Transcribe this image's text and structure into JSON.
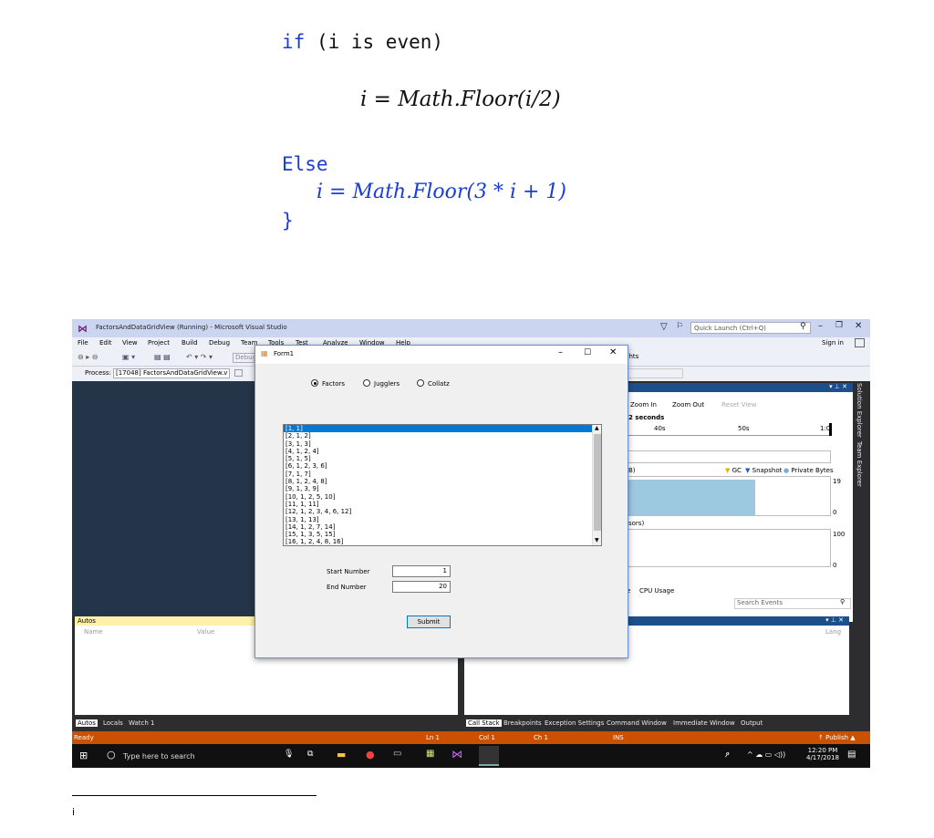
{
  "code": {
    "if_line": "if (i is even)",
    "even_formula": "i = Math.Floor(i/2)",
    "else_kw": "Else",
    "odd_formula": "i = Math.Floor(3 * i + 1)",
    "close_brace": "}"
  },
  "vs": {
    "title": "FactorsAndDataGridView (Running) - Microsoft Visual Studio",
    "quick_launch": "Quick Launch (Ctrl+Q)",
    "sign_in": "Sign in",
    "menu": [
      "File",
      "Edit",
      "View",
      "Project",
      "Build",
      "Debug",
      "Team",
      "Tools",
      "Test",
      "Analyze",
      "Window",
      "Help"
    ],
    "process_label": "Process:",
    "process_value": "[17048] FactorsAndDataGridView.v",
    "toolbar_debug": "Debug",
    "insights": "ghts",
    "diag": {
      "zoom_in": "Zoom In",
      "zoom_out": "Zoom Out",
      "reset_view": "Reset View",
      "seconds": "2 seconds",
      "ticks": [
        "40s",
        "50s",
        "1:0"
      ],
      "memory_label": "B)",
      "legend_gc": "GC",
      "legend_snapshot": "Snapshot",
      "legend_private": "Private Bytes",
      "mem_max": "19",
      "mem_min": "0",
      "cpu_label": "sors)",
      "cpu_max": "100",
      "cpu_min": "0",
      "tab_events": "e",
      "tab_cpu": "CPU Usage",
      "search_events": "Search Events"
    },
    "side_tabs": [
      "Solution Explorer",
      "Team Explorer"
    ],
    "autos": {
      "title": "Autos",
      "col_name": "Name",
      "col_value": "Value"
    },
    "callstack": {
      "col_lang": "Lang"
    },
    "bottom_left_tabs": [
      "Autos",
      "Locals",
      "Watch 1"
    ],
    "bottom_right_tabs": [
      "Call Stack",
      "Breakpoints",
      "Exception Settings",
      "Command Window",
      "Immediate Window",
      "Output"
    ],
    "status": {
      "ready": "Ready",
      "ln": "Ln 1",
      "col": "Col 1",
      "ch": "Ch 1",
      "ins": "INS",
      "publish": "↑ Publish ▲"
    },
    "taskbar": {
      "search": "Type here to search",
      "time": "12:20 PM",
      "date": "4/17/2018"
    }
  },
  "form": {
    "title": "Form1",
    "radios": [
      "Factors",
      "Jugglers",
      "Collatz"
    ],
    "selected_radio": "Factors",
    "list": [
      "[1, 1]",
      "[2, 1, 2]",
      "[3, 1, 3]",
      "[4, 1, 2, 4]",
      "[5, 1, 5]",
      "[6, 1, 2, 3, 6]",
      "[7, 1, 7]",
      "[8, 1, 2, 4, 8]",
      "[9, 1, 3, 9]",
      "[10, 1, 2, 5, 10]",
      "[11, 1, 11]",
      "[12, 1, 2, 3, 4, 6, 12]",
      "[13, 1, 13]",
      "[14, 1, 2, 7, 14]",
      "[15, 1, 3, 5, 15]",
      "[16, 1, 2, 4, 8, 16]"
    ],
    "start_label": "Start Number",
    "start_value": "1",
    "end_label": "End Number",
    "end_value": "20",
    "submit": "Submit"
  },
  "footnote": "i"
}
